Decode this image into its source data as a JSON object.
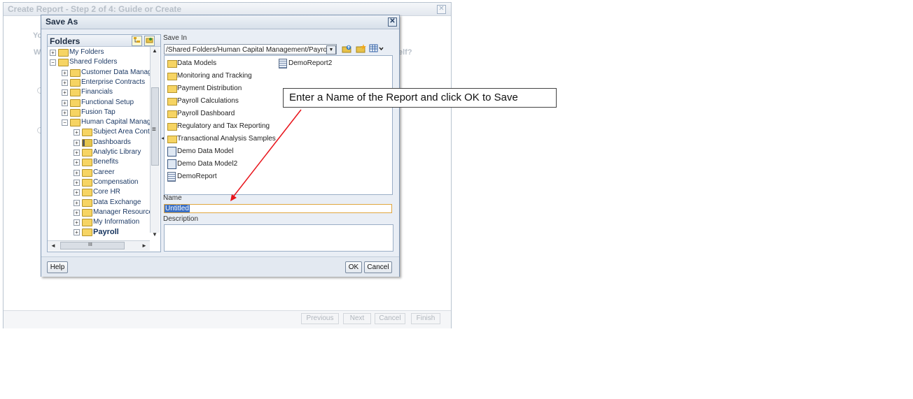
{
  "wizard": {
    "title": "Create Report - Step 2 of 4: Guide or Create",
    "close_glyph": "✕",
    "ghost_text_1": "Yo",
    "ghost_text_2": "W",
    "ghost_text_3": "elf?",
    "buttons": {
      "previous": "Previous",
      "next": "Next",
      "cancel": "Cancel",
      "finish": "Finish"
    }
  },
  "dialog": {
    "title": "Save As",
    "close_glyph": "✕",
    "folders": {
      "title": "Folders",
      "tree": [
        {
          "label": "My Folders",
          "expander": "+"
        },
        {
          "label": "Shared Folders",
          "expander": "−"
        },
        {
          "label": "Customer Data Manag",
          "expander": "+"
        },
        {
          "label": "Enterprise Contracts",
          "expander": "+"
        },
        {
          "label": "Financials",
          "expander": "+"
        },
        {
          "label": "Functional Setup",
          "expander": "+"
        },
        {
          "label": "Fusion Tap",
          "expander": "+"
        },
        {
          "label": "Human Capital Manage",
          "expander": "−"
        },
        {
          "label": "Subject Area Cont",
          "expander": "+"
        },
        {
          "label": "Dashboards",
          "expander": "+"
        },
        {
          "label": "Analytic Library",
          "expander": "+"
        },
        {
          "label": "Benefits",
          "expander": "+"
        },
        {
          "label": "Career",
          "expander": "+"
        },
        {
          "label": "Compensation",
          "expander": "+"
        },
        {
          "label": "Core HR",
          "expander": "+"
        },
        {
          "label": "Data Exchange",
          "expander": "+"
        },
        {
          "label": "Manager Resource",
          "expander": "+"
        },
        {
          "label": "My Information",
          "expander": "+"
        },
        {
          "label": "Payroll",
          "expander": "+",
          "selected": true
        }
      ],
      "scroll_glyphs": {
        "up": "▲",
        "down": "▼",
        "left": "◄",
        "right": "►",
        "grip": "III",
        "side": "≡"
      }
    },
    "save_in": {
      "label": "Save In",
      "path": "/Shared Folders/Human Capital Management/Payroll",
      "dropdown_glyph": "▼"
    },
    "items_col1": [
      {
        "label": "Data Models",
        "kind": "folder"
      },
      {
        "label": "Monitoring and Tracking",
        "kind": "folder"
      },
      {
        "label": "Payment Distribution",
        "kind": "folder"
      },
      {
        "label": "Payroll Calculations",
        "kind": "folder"
      },
      {
        "label": "Payroll Dashboard",
        "kind": "folder"
      },
      {
        "label": "Regulatory and Tax Reporting",
        "kind": "folder"
      },
      {
        "label": "Transactional Analysis Samples",
        "kind": "folder"
      },
      {
        "label": "Demo Data Model",
        "kind": "datamodel"
      },
      {
        "label": "Demo Data Model2",
        "kind": "datamodel"
      },
      {
        "label": "DemoReport",
        "kind": "report"
      }
    ],
    "items_col2": [
      {
        "label": "DemoReport2",
        "kind": "report"
      }
    ],
    "name": {
      "label": "Name",
      "value": "Untitled"
    },
    "description": {
      "label": "Description",
      "value": ""
    },
    "buttons": {
      "help": "Help",
      "ok": "OK",
      "cancel": "Cancel"
    }
  },
  "callout": {
    "text": "Enter a Name of the Report and click OK to Save",
    "arrow_color": "#e8141b"
  }
}
